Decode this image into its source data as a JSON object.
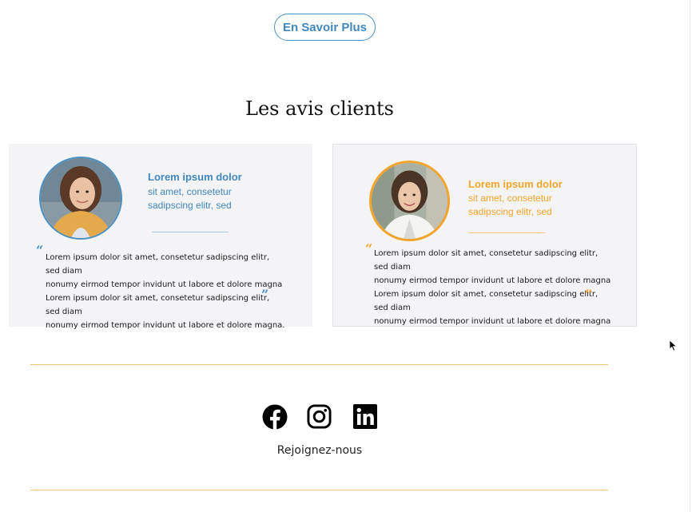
{
  "cta": {
    "label": "En Savoir Plus"
  },
  "reviews_section": {
    "title": "Les avis clients",
    "cards": [
      {
        "name": "Lorem ipsum dolor",
        "subtitle_line1": "sit amet, consetetur",
        "subtitle_line2": "sadipscing elitr, sed",
        "quote_open": "“",
        "quote_close": "”",
        "text_line1": "Lorem ipsum dolor sit amet, consetetur sadipscing elitr, sed diam",
        "text_line2": "nonumy eirmod tempor invidunt ut labore et dolore magna",
        "text_line3": "Lorem ipsum dolor sit amet, consetetur sadipscing elitr, sed diam",
        "text_line4": "nonumy eirmod tempor invidunt ut labore et dolore magna.",
        "accent_color": "#4a90c2",
        "avatar_icon": "woman-smiling-avatar"
      },
      {
        "name": "Lorem ipsum dolor",
        "subtitle_line1": "sit amet, consetetur",
        "subtitle_line2": "sadipscing elitr, sed",
        "quote_open": "“",
        "quote_close": "”",
        "text_line1": "Lorem ipsum dolor sit amet, consetetur sadipscing elitr, sed diam",
        "text_line2": "nonumy eirmod tempor invidunt ut labore et dolore magna",
        "text_line3": "Lorem ipsum dolor sit amet, consetetur sadipscing elitr, sed diam",
        "text_line4": "nonumy eirmod tempor invidunt ut labore et dolore magna",
        "accent_color": "#f2a52b",
        "avatar_icon": "woman-professional-avatar"
      }
    ]
  },
  "social": {
    "icons": [
      "facebook-icon",
      "instagram-icon",
      "linkedin-icon"
    ],
    "join_label": "Rejoignez-nous"
  },
  "colors": {
    "primary_blue": "#4a90c2",
    "accent_orange": "#f2a52b",
    "divider_gold": "#f2c46d",
    "card_bg": "#f4f3f6"
  }
}
